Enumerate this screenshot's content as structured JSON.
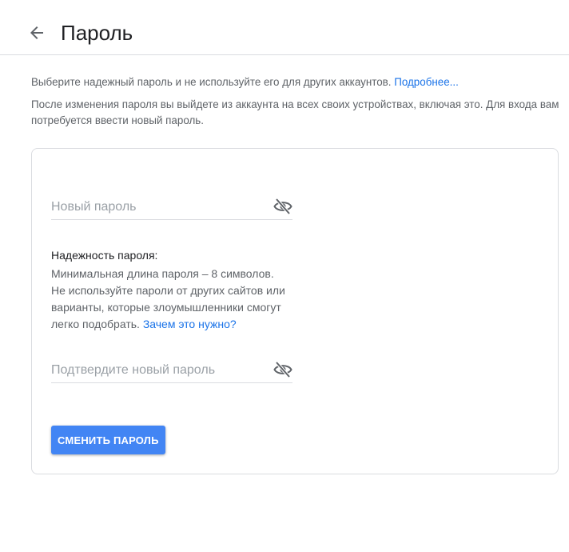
{
  "header": {
    "title": "Пароль"
  },
  "intro": {
    "line1_text": "Выберите надежный пароль и не используйте его для других аккаунтов. ",
    "line1_link": "Подробнее...",
    "line2_text": "После изменения пароля вы выйдете из аккаунта на всех своих устройствах, включая это. Для входа вам потребуется ввести новый пароль."
  },
  "form": {
    "new_password": {
      "placeholder": "Новый пароль",
      "value": ""
    },
    "strength": {
      "title": "Надежность пароля:",
      "text": "Минимальная длина пароля – 8 символов. Не используйте пароли от других сайтов или варианты, которые злоумышленники смогут легко подобрать. ",
      "link": "Зачем это нужно?"
    },
    "confirm_password": {
      "placeholder": "Подтвердите новый пароль",
      "value": ""
    },
    "submit_label": "СМЕНИТЬ ПАРОЛЬ"
  },
  "icons": {
    "back": "arrow-back-icon",
    "toggle_visibility": "eye-off-icon"
  },
  "colors": {
    "accent": "#4285f4",
    "link": "#1a73e8",
    "divider": "#dadce0",
    "text_primary": "#202124",
    "text_secondary": "#5f6368"
  }
}
